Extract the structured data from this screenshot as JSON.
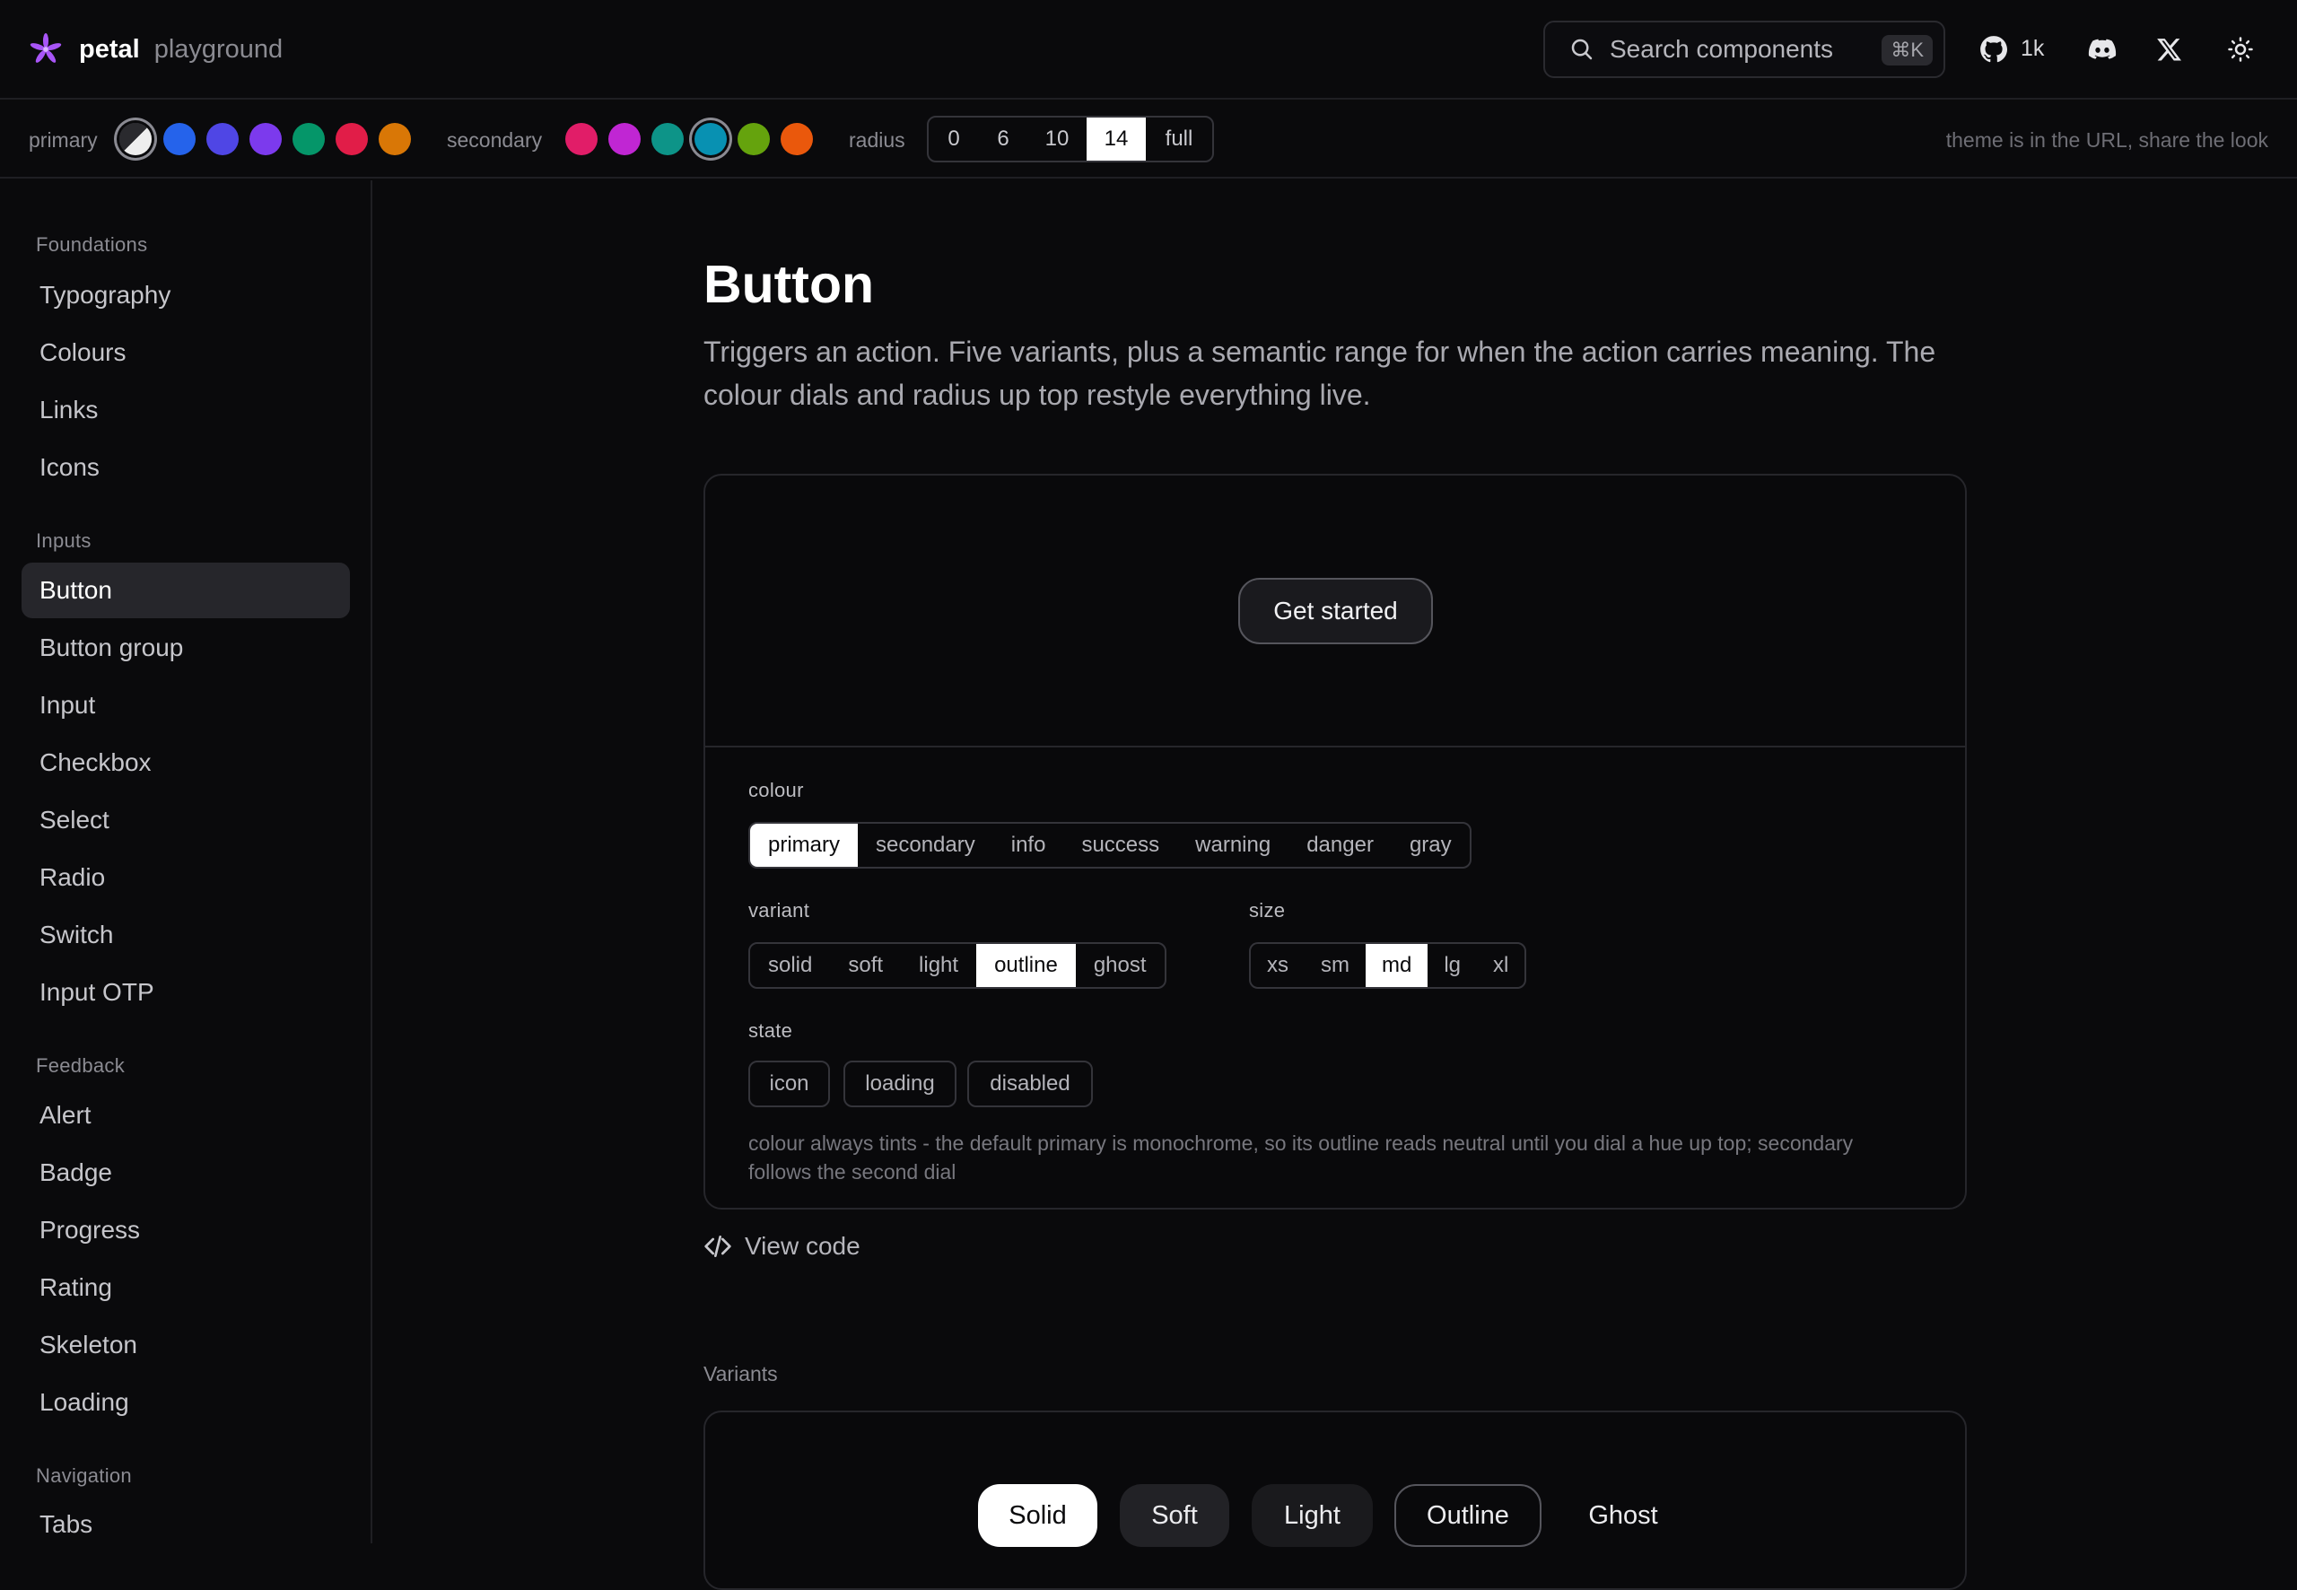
{
  "header": {
    "brand_name": "petal",
    "brand_sub": "playground",
    "search_placeholder": "Search components",
    "search_shortcut": "⌘K",
    "github_count": "1k",
    "icons": [
      "logo-icon",
      "search-icon",
      "github-icon",
      "discord-icon",
      "x-icon",
      "sun-icon"
    ]
  },
  "themebar": {
    "primary_label": "primary",
    "primary_swatches": [
      "#e8e8e8",
      "#2563eb",
      "#4f46e5",
      "#7c3aed",
      "#059669",
      "#e11d48",
      "#d97706"
    ],
    "secondary_label": "secondary",
    "secondary_swatches": [
      "#e11d68",
      "#c026d3",
      "#0d9488",
      "#0891b2",
      "#65a30d",
      "#ea580c"
    ],
    "radius_label": "radius",
    "radius_options": [
      "0",
      "6",
      "10",
      "14",
      "full"
    ],
    "radius_selected": "14",
    "note": "theme is in the URL, share the look"
  },
  "sidebar": {
    "sections": [
      {
        "title": "Foundations",
        "items": [
          "Typography",
          "Colours",
          "Links",
          "Icons"
        ]
      },
      {
        "title": "Inputs",
        "items": [
          "Button",
          "Button group",
          "Input",
          "Checkbox",
          "Select",
          "Radio",
          "Switch",
          "Input OTP"
        ]
      },
      {
        "title": "Feedback",
        "items": [
          "Alert",
          "Badge",
          "Progress",
          "Rating",
          "Skeleton",
          "Loading"
        ]
      },
      {
        "title": "Navigation",
        "items": [
          "Tabs"
        ]
      }
    ],
    "active_item": "Button"
  },
  "main": {
    "title": "Button",
    "description": "Triggers an action. Five variants, plus a semantic range for when the action carries meaning. The colour dials and radius up top restyle everything live.",
    "preview_button": "Get started",
    "controls": {
      "colour_label": "colour",
      "colour_options": [
        "primary",
        "secondary",
        "info",
        "success",
        "warning",
        "danger",
        "gray"
      ],
      "colour_selected": "primary",
      "variant_label": "variant",
      "variant_options": [
        "solid",
        "soft",
        "light",
        "outline",
        "ghost"
      ],
      "variant_selected": "outline",
      "size_label": "size",
      "size_options": [
        "xs",
        "sm",
        "md",
        "lg",
        "xl"
      ],
      "size_selected": "md",
      "state_label": "state",
      "state_options": [
        "icon",
        "loading",
        "disabled"
      ]
    },
    "note": "colour always tints - the default primary is monochrome, so its outline reads neutral until you dial a hue up top; secondary follows the second dial",
    "view_code": "View code",
    "variants_section": "Variants",
    "variant_buttons": [
      "Solid",
      "Soft",
      "Light",
      "Outline",
      "Ghost"
    ]
  }
}
